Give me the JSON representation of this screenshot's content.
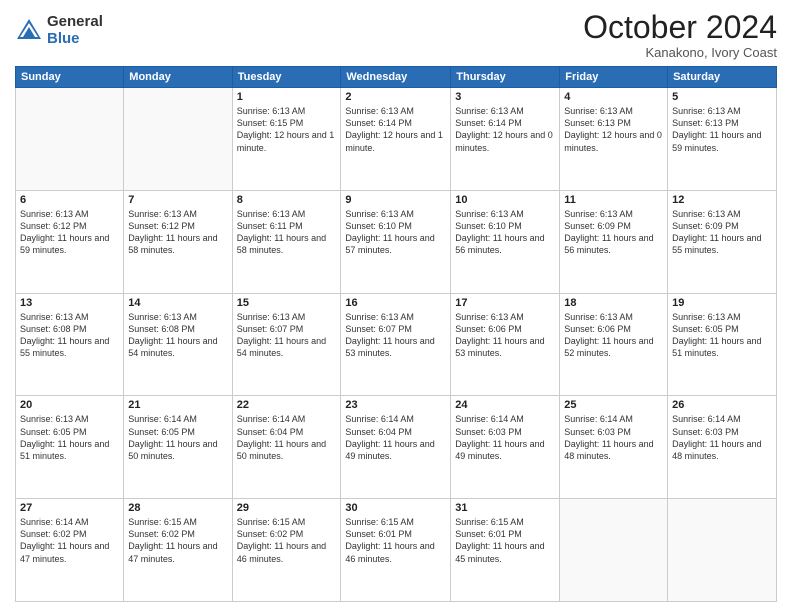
{
  "header": {
    "logo_general": "General",
    "logo_blue": "Blue",
    "month_title": "October 2024",
    "location": "Kanakono, Ivory Coast"
  },
  "days_of_week": [
    "Sunday",
    "Monday",
    "Tuesday",
    "Wednesday",
    "Thursday",
    "Friday",
    "Saturday"
  ],
  "weeks": [
    [
      {
        "day": "",
        "info": ""
      },
      {
        "day": "",
        "info": ""
      },
      {
        "day": "1",
        "info": "Sunrise: 6:13 AM\nSunset: 6:15 PM\nDaylight: 12 hours and 1 minute."
      },
      {
        "day": "2",
        "info": "Sunrise: 6:13 AM\nSunset: 6:14 PM\nDaylight: 12 hours and 1 minute."
      },
      {
        "day": "3",
        "info": "Sunrise: 6:13 AM\nSunset: 6:14 PM\nDaylight: 12 hours and 0 minutes."
      },
      {
        "day": "4",
        "info": "Sunrise: 6:13 AM\nSunset: 6:13 PM\nDaylight: 12 hours and 0 minutes."
      },
      {
        "day": "5",
        "info": "Sunrise: 6:13 AM\nSunset: 6:13 PM\nDaylight: 11 hours and 59 minutes."
      }
    ],
    [
      {
        "day": "6",
        "info": "Sunrise: 6:13 AM\nSunset: 6:12 PM\nDaylight: 11 hours and 59 minutes."
      },
      {
        "day": "7",
        "info": "Sunrise: 6:13 AM\nSunset: 6:12 PM\nDaylight: 11 hours and 58 minutes."
      },
      {
        "day": "8",
        "info": "Sunrise: 6:13 AM\nSunset: 6:11 PM\nDaylight: 11 hours and 58 minutes."
      },
      {
        "day": "9",
        "info": "Sunrise: 6:13 AM\nSunset: 6:10 PM\nDaylight: 11 hours and 57 minutes."
      },
      {
        "day": "10",
        "info": "Sunrise: 6:13 AM\nSunset: 6:10 PM\nDaylight: 11 hours and 56 minutes."
      },
      {
        "day": "11",
        "info": "Sunrise: 6:13 AM\nSunset: 6:09 PM\nDaylight: 11 hours and 56 minutes."
      },
      {
        "day": "12",
        "info": "Sunrise: 6:13 AM\nSunset: 6:09 PM\nDaylight: 11 hours and 55 minutes."
      }
    ],
    [
      {
        "day": "13",
        "info": "Sunrise: 6:13 AM\nSunset: 6:08 PM\nDaylight: 11 hours and 55 minutes."
      },
      {
        "day": "14",
        "info": "Sunrise: 6:13 AM\nSunset: 6:08 PM\nDaylight: 11 hours and 54 minutes."
      },
      {
        "day": "15",
        "info": "Sunrise: 6:13 AM\nSunset: 6:07 PM\nDaylight: 11 hours and 54 minutes."
      },
      {
        "day": "16",
        "info": "Sunrise: 6:13 AM\nSunset: 6:07 PM\nDaylight: 11 hours and 53 minutes."
      },
      {
        "day": "17",
        "info": "Sunrise: 6:13 AM\nSunset: 6:06 PM\nDaylight: 11 hours and 53 minutes."
      },
      {
        "day": "18",
        "info": "Sunrise: 6:13 AM\nSunset: 6:06 PM\nDaylight: 11 hours and 52 minutes."
      },
      {
        "day": "19",
        "info": "Sunrise: 6:13 AM\nSunset: 6:05 PM\nDaylight: 11 hours and 51 minutes."
      }
    ],
    [
      {
        "day": "20",
        "info": "Sunrise: 6:13 AM\nSunset: 6:05 PM\nDaylight: 11 hours and 51 minutes."
      },
      {
        "day": "21",
        "info": "Sunrise: 6:14 AM\nSunset: 6:05 PM\nDaylight: 11 hours and 50 minutes."
      },
      {
        "day": "22",
        "info": "Sunrise: 6:14 AM\nSunset: 6:04 PM\nDaylight: 11 hours and 50 minutes."
      },
      {
        "day": "23",
        "info": "Sunrise: 6:14 AM\nSunset: 6:04 PM\nDaylight: 11 hours and 49 minutes."
      },
      {
        "day": "24",
        "info": "Sunrise: 6:14 AM\nSunset: 6:03 PM\nDaylight: 11 hours and 49 minutes."
      },
      {
        "day": "25",
        "info": "Sunrise: 6:14 AM\nSunset: 6:03 PM\nDaylight: 11 hours and 48 minutes."
      },
      {
        "day": "26",
        "info": "Sunrise: 6:14 AM\nSunset: 6:03 PM\nDaylight: 11 hours and 48 minutes."
      }
    ],
    [
      {
        "day": "27",
        "info": "Sunrise: 6:14 AM\nSunset: 6:02 PM\nDaylight: 11 hours and 47 minutes."
      },
      {
        "day": "28",
        "info": "Sunrise: 6:15 AM\nSunset: 6:02 PM\nDaylight: 11 hours and 47 minutes."
      },
      {
        "day": "29",
        "info": "Sunrise: 6:15 AM\nSunset: 6:02 PM\nDaylight: 11 hours and 46 minutes."
      },
      {
        "day": "30",
        "info": "Sunrise: 6:15 AM\nSunset: 6:01 PM\nDaylight: 11 hours and 46 minutes."
      },
      {
        "day": "31",
        "info": "Sunrise: 6:15 AM\nSunset: 6:01 PM\nDaylight: 11 hours and 45 minutes."
      },
      {
        "day": "",
        "info": ""
      },
      {
        "day": "",
        "info": ""
      }
    ]
  ]
}
